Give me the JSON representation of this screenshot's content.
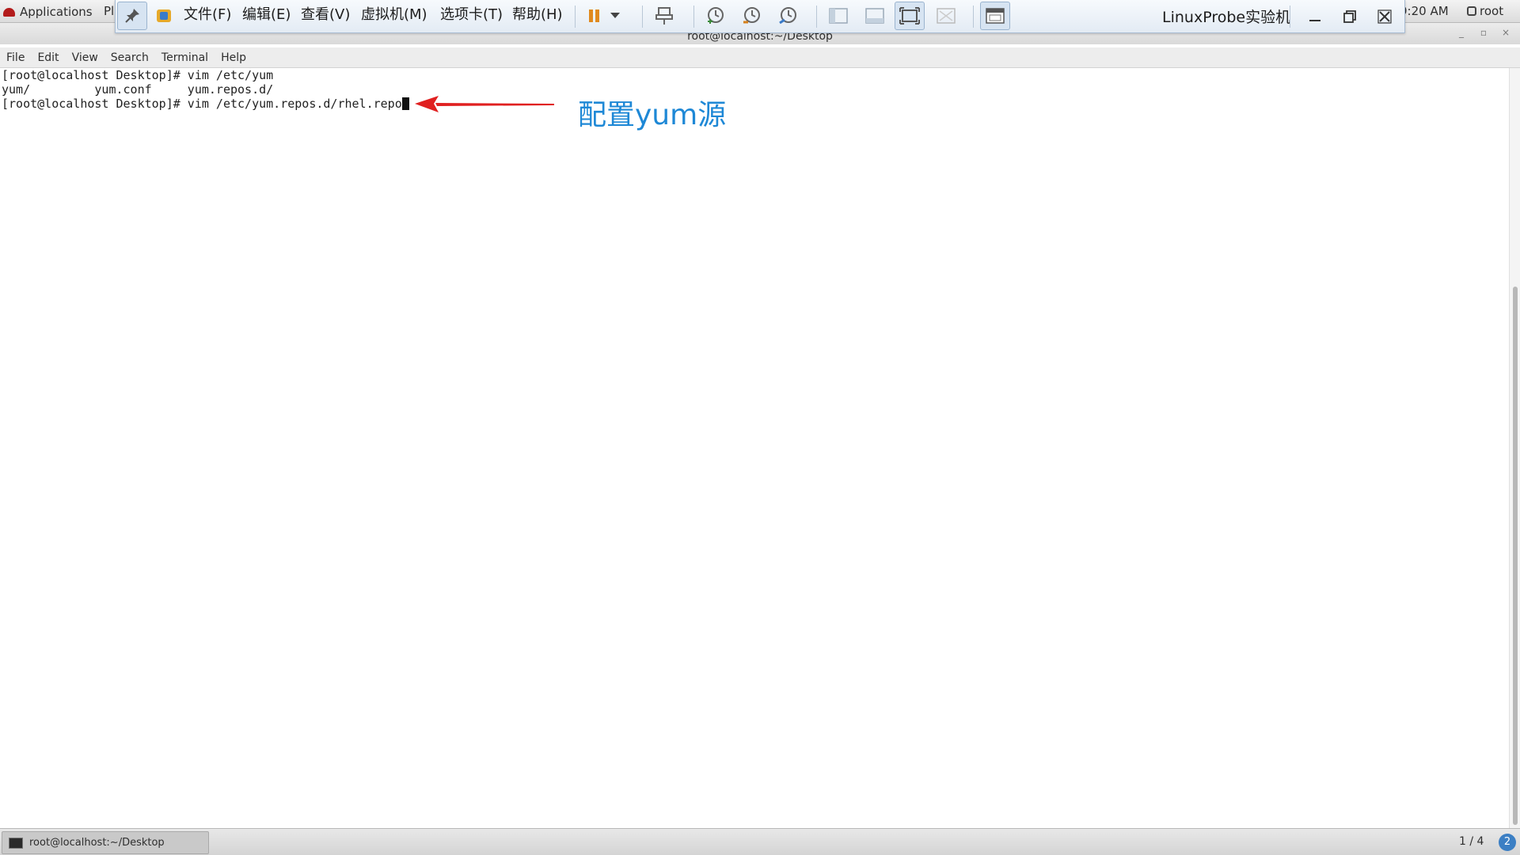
{
  "gnome_bar": {
    "applications": "Applications",
    "places": "Pl",
    "clock": "9:20 AM",
    "user": "root"
  },
  "vm_toolbar": {
    "menus": [
      "文件(F)",
      "编辑(E)",
      "查看(V)",
      "虚拟机(M)",
      "选项卡(T)",
      "帮助(H)"
    ],
    "title": "LinuxProbe实验机"
  },
  "terminal": {
    "window_title": "root@localhost:~/Desktop",
    "menubar": [
      "File",
      "Edit",
      "View",
      "Search",
      "Terminal",
      "Help"
    ],
    "lines": [
      "[root@localhost Desktop]# vim /etc/yum",
      "yum/         yum.conf     yum.repos.d/",
      "[root@localhost Desktop]# vim /etc/yum.repos.d/rhel.repo"
    ]
  },
  "annotation": {
    "text": "配置yum源",
    "color": "#1e88d6",
    "arrow_color": "#e02020"
  },
  "taskbar": {
    "task_label": "root@localhost:~/Desktop",
    "workspace": "1 / 4",
    "badge": "2"
  }
}
